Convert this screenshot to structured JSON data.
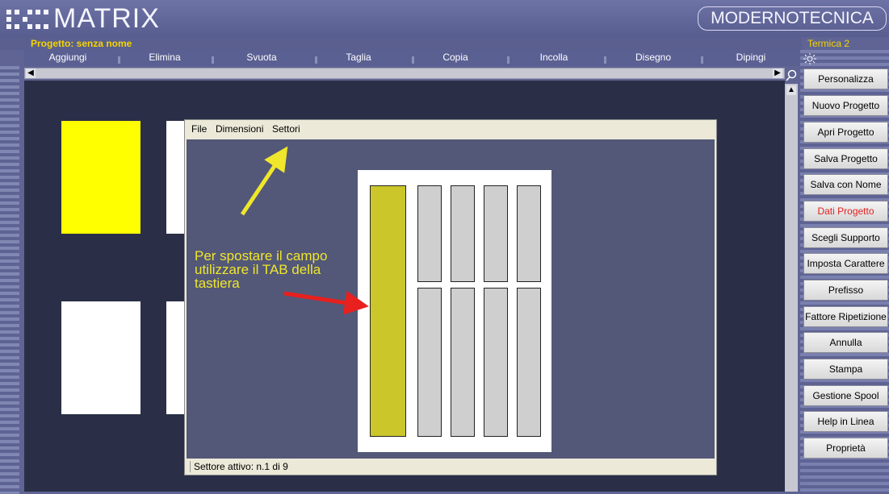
{
  "app": {
    "title": "MATRIX",
    "brand": "MODERNOTECNICA"
  },
  "project": {
    "label": "Progetto: senza nome",
    "printer": "Termica 2"
  },
  "menu": [
    "Aggiungi",
    "Elimina",
    "Svuota",
    "Taglia",
    "Copia",
    "Incolla",
    "Disegno",
    "Dipingi"
  ],
  "dialog": {
    "menu": [
      "File",
      "Dimensioni",
      "Settori"
    ],
    "annotation": [
      "Per spostare il campo",
      "utilizzare il TAB della",
      "tastiera"
    ],
    "status": "Settore attivo: n.1 di 9"
  },
  "side_buttons": [
    {
      "label": "Personalizza"
    },
    {
      "label": "Nuovo Progetto"
    },
    {
      "label": "Apri Progetto"
    },
    {
      "label": "Salva Progetto"
    },
    {
      "label": "Salva con Nome"
    },
    {
      "label": "Dati Progetto",
      "highlight": true
    },
    {
      "label": "Scegli Supporto"
    },
    {
      "label": "Imposta Carattere"
    },
    {
      "label": "Prefisso"
    },
    {
      "label": "Fattore Ripetizione"
    },
    {
      "label": "Annulla"
    },
    {
      "label": "Stampa"
    },
    {
      "label": "Gestione Spool"
    },
    {
      "label": "Help in Linea"
    },
    {
      "label": "Proprietà"
    }
  ],
  "icons": {
    "logo": "matrix-dots-icon",
    "scroll_left": "arrow-left-icon",
    "scroll_right": "arrow-right-icon",
    "scroll_up": "arrow-up-icon",
    "zoom": "magnifier-icon",
    "settings": "sun-icon"
  },
  "colors": {
    "accent_yellow": "#f5d400",
    "active_sector": "#cbc62a",
    "highlight_text": "#e32020"
  }
}
